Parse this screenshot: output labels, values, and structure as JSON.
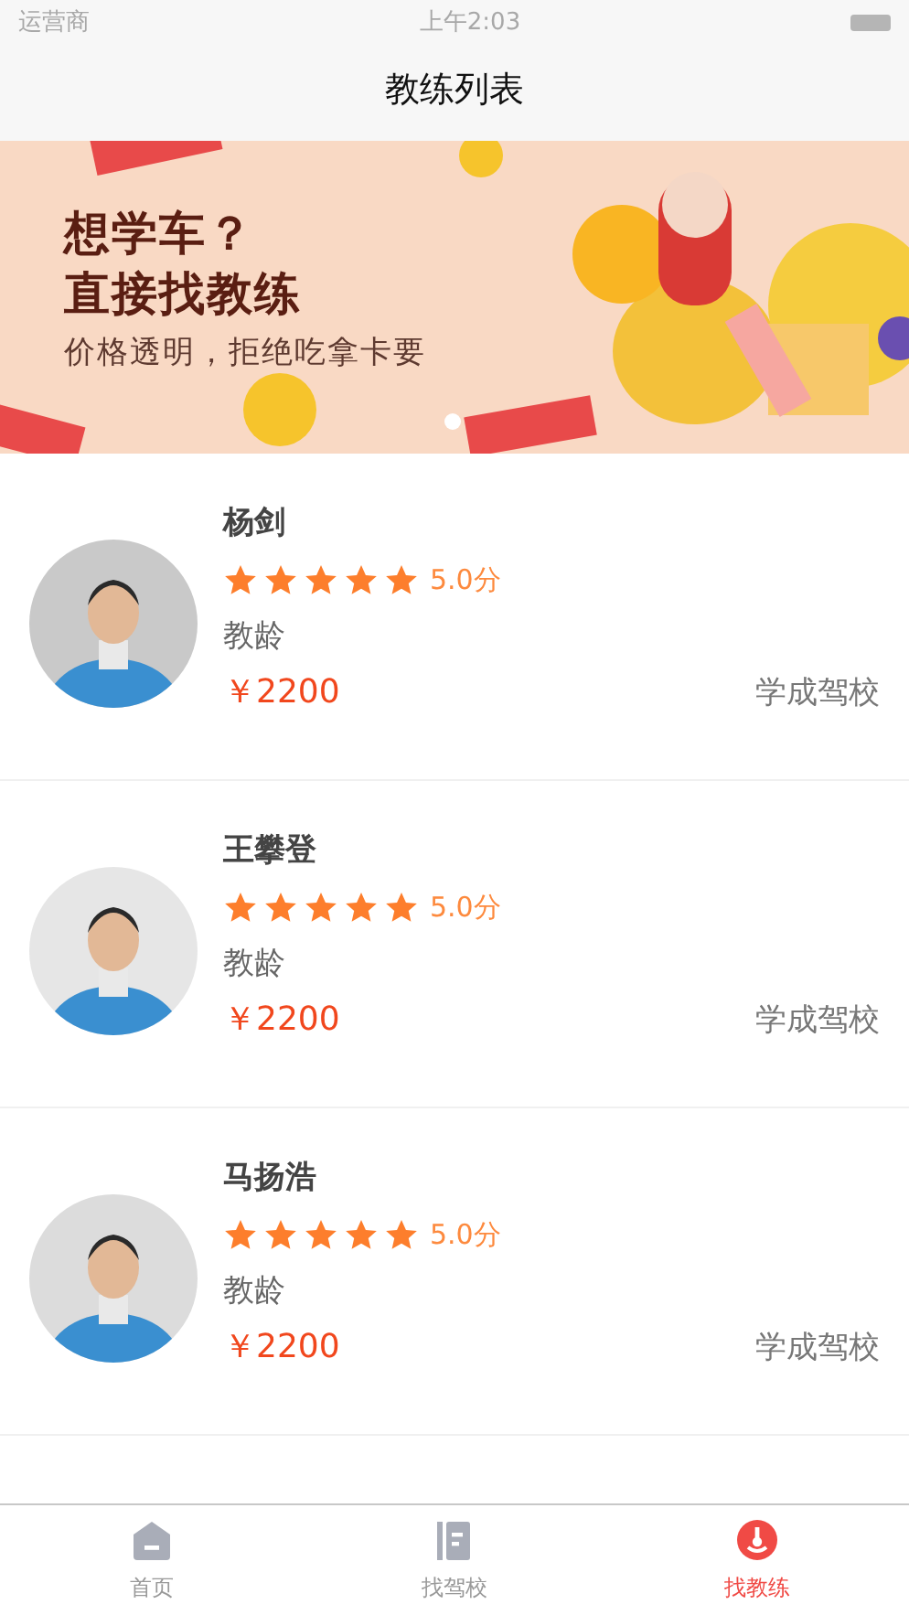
{
  "status_bar": {
    "carrier": "运营商",
    "time": "上午2:03"
  },
  "nav": {
    "title": "教练列表"
  },
  "banner": {
    "kind": "picture",
    "headline": "想学车？",
    "headline_2": "直接找教练",
    "tagline": "价格透明，拒绝吃拿卡要",
    "pages": [
      {
        "selected": true
      }
    ]
  },
  "coaches": [
    {
      "name": "杨剑",
      "stars": 5,
      "rating": "5.0分",
      "label": "教龄",
      "price": "￥2200",
      "school": "学成驾校"
    },
    {
      "name": "王攀登",
      "stars": 5,
      "rating": "5.0分",
      "label": "教龄",
      "price": "￥2200",
      "school": "学成驾校"
    },
    {
      "name": "马扬浩",
      "stars": 5,
      "rating": "5.0分",
      "label": "教龄",
      "price": "￥2200",
      "school": "学成驾校"
    }
  ],
  "tabs": [
    {
      "label": "首页",
      "kind": "home",
      "selected": false
    },
    {
      "label": "找驾校",
      "kind": "school",
      "selected": false
    },
    {
      "label": "找教练",
      "kind": "coach",
      "selected": true
    }
  ]
}
